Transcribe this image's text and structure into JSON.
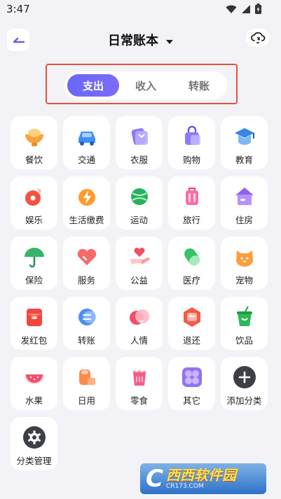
{
  "status": {
    "time": "3:47"
  },
  "header": {
    "title": "日常账本"
  },
  "tabs": [
    {
      "label": "支出",
      "active": true
    },
    {
      "label": "收入",
      "active": false
    },
    {
      "label": "转账",
      "active": false
    }
  ],
  "categories": [
    {
      "label": "餐饮",
      "icon": "bowl-icon"
    },
    {
      "label": "交通",
      "icon": "car-icon"
    },
    {
      "label": "衣服",
      "icon": "clothes-icon"
    },
    {
      "label": "购物",
      "icon": "shopping-bag-icon"
    },
    {
      "label": "教育",
      "icon": "graduation-cap-icon"
    },
    {
      "label": "娱乐",
      "icon": "music-disc-icon"
    },
    {
      "label": "生活缴费",
      "icon": "lightning-icon"
    },
    {
      "label": "运动",
      "icon": "ball-icon"
    },
    {
      "label": "旅行",
      "icon": "suitcase-icon"
    },
    {
      "label": "住房",
      "icon": "house-icon"
    },
    {
      "label": "保险",
      "icon": "umbrella-icon"
    },
    {
      "label": "服务",
      "icon": "heart-icon"
    },
    {
      "label": "公益",
      "icon": "hand-heart-icon"
    },
    {
      "label": "医疗",
      "icon": "pill-icon"
    },
    {
      "label": "宠物",
      "icon": "pet-icon"
    },
    {
      "label": "发红包",
      "icon": "red-envelope-icon"
    },
    {
      "label": "转账",
      "icon": "transfer-icon"
    },
    {
      "label": "人情",
      "icon": "gift-circle-icon"
    },
    {
      "label": "退还",
      "icon": "refund-icon"
    },
    {
      "label": "饮品",
      "icon": "drink-cup-icon"
    },
    {
      "label": "水果",
      "icon": "watermelon-icon"
    },
    {
      "label": "日用",
      "icon": "tissue-roll-icon"
    },
    {
      "label": "零食",
      "icon": "snack-icon"
    },
    {
      "label": "其它",
      "icon": "grid-flower-icon"
    },
    {
      "label": "添加分类",
      "icon": "plus-circle-icon"
    },
    {
      "label": "分类管理",
      "icon": "gear-icon"
    }
  ],
  "watermark": {
    "main": "西西软件园",
    "sub": "CR173.COM",
    "logo_letter": "C"
  }
}
